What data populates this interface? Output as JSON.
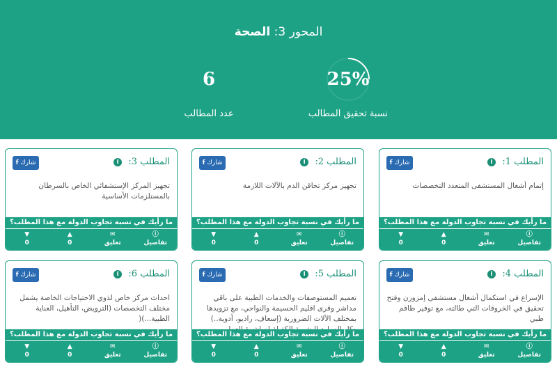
{
  "header": {
    "title_prefix": "المحور 3:",
    "title_name": "الصحة",
    "progress_value": "25%",
    "progress_fraction": 0.25,
    "progress_label": "نسبة تحقيق المطالب",
    "count_value": "6",
    "count_label": "عدد المطالب"
  },
  "colors": {
    "accent": "#1ea286",
    "share": "#2a6bb2"
  },
  "cards": [
    {
      "title": "المطلب 1:",
      "desc": "إتمام أشغال المستشفى المتعدد التخصصات",
      "share": "شارك",
      "question": "ما رأيك في نسبة تجاوب الدولة مع هذا المطلب؟",
      "details": "تفاصيل",
      "comment": "تعليق",
      "comments_count": "0",
      "likes": "0",
      "dislikes": "0"
    },
    {
      "title": "المطلب 2:",
      "desc": "تجهيز مركز تحاقن الدم بالآلات اللازمة",
      "share": "شارك",
      "question": "ما رأيك في نسبة تجاوب الدولة مع هذا المطلب؟",
      "details": "تفاصيل",
      "comment": "تعليق",
      "comments_count": "0",
      "likes": "0",
      "dislikes": "0"
    },
    {
      "title": "المطلب 3:",
      "desc": "تجهيز المركز الإستشفائي الخاص بالسرطان بالمستلزمات الأساسية",
      "share": "شارك",
      "question": "ما رأيك في نسبة تجاوب الدولة مع هذا المطلب؟",
      "details": "تفاصيل",
      "comment": "تعليق",
      "comments_count": "0",
      "likes": "0",
      "dislikes": "0"
    },
    {
      "title": "المطلب 4:",
      "desc": "الإسراع في استكمال أشغال مستشفى إمزورن وفتح تحقيق في الخروقات التي طالته، مع توفير طاقم طبي",
      "share": "شارك",
      "question": "ما رأيك في نسبة تجاوب الدولة مع هذا المطلب؟",
      "details": "تفاصيل",
      "comment": "تعليق",
      "comments_count": "0",
      "likes": "0",
      "dislikes": "0"
    },
    {
      "title": "المطلب 5:",
      "desc": "تعميم المستوصفات والخدمات الطبية على باقي مداشر وقرى اقليم الحسيمة والنواحي، مع تزويدها بمختلف الآلات الضرورية (إسعاف، راديو، أدوية..) وكل الموارد البشرية الكفيلة لمباشرة العمل فيها(مطلب استعجالي)",
      "share": "شارك",
      "question": "ما رأيك في نسبة تجاوب الدولة مع هذا المطلب؟",
      "details": "تفاصيل",
      "comment": "تعليق",
      "comments_count": "0",
      "likes": "0",
      "dislikes": "0"
    },
    {
      "title": "المطلب 6:",
      "desc": "احداث مركز خاص لذوي الاحتياجات الخاصة يشمل مختلف التخصصات (الترويض، التأهيل، العناية الطبية...)(",
      "share": "شارك",
      "question": "ما رأيك في نسبة تجاوب الدولة مع هذا المطلب؟",
      "details": "تفاصيل",
      "comment": "تعليق",
      "comments_count": "0",
      "likes": "0",
      "dislikes": "0"
    }
  ]
}
